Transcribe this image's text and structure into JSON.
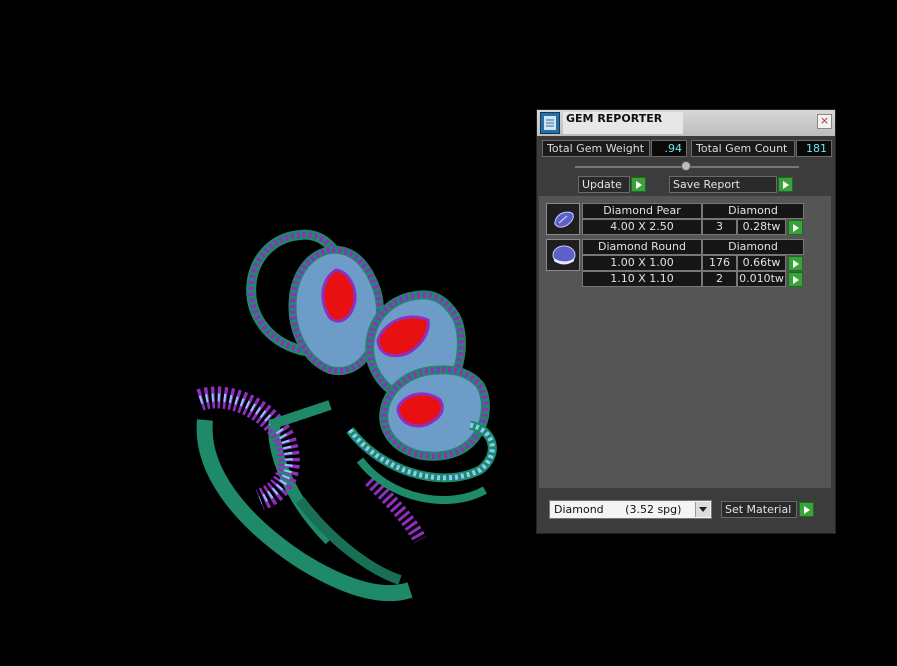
{
  "panel": {
    "title": "GEM REPORTER",
    "close_symbol": "×",
    "total_weight_label": "Total Gem Weight",
    "total_weight_value": ".94",
    "total_count_label": "Total Gem Count",
    "total_count_value": "181",
    "update_label": "Update",
    "save_report_label": "Save Report",
    "gems": [
      {
        "name": "Diamond Pear",
        "material": "Diamond",
        "rows": [
          {
            "size": "4.00 X 2.50",
            "count": "3",
            "weight": "0.28tw"
          }
        ]
      },
      {
        "name": "Diamond Round",
        "material": "Diamond",
        "rows": [
          {
            "size": "1.00 X 1.00",
            "count": "176",
            "weight": "0.66tw"
          },
          {
            "size": "1.10 X 1.10",
            "count": "2",
            "weight": "0.010tw"
          }
        ]
      }
    ],
    "material_select": {
      "name": "Diamond",
      "density": "(3.52 spg)"
    },
    "set_material_label": "Set Material"
  },
  "colors": {
    "metal": "#1f8a6a",
    "small_stones": "#8f2fc0",
    "stone_highlight": "#8fc8ff",
    "center_stones": "#e81010",
    "go_button": "#3aa23a"
  }
}
